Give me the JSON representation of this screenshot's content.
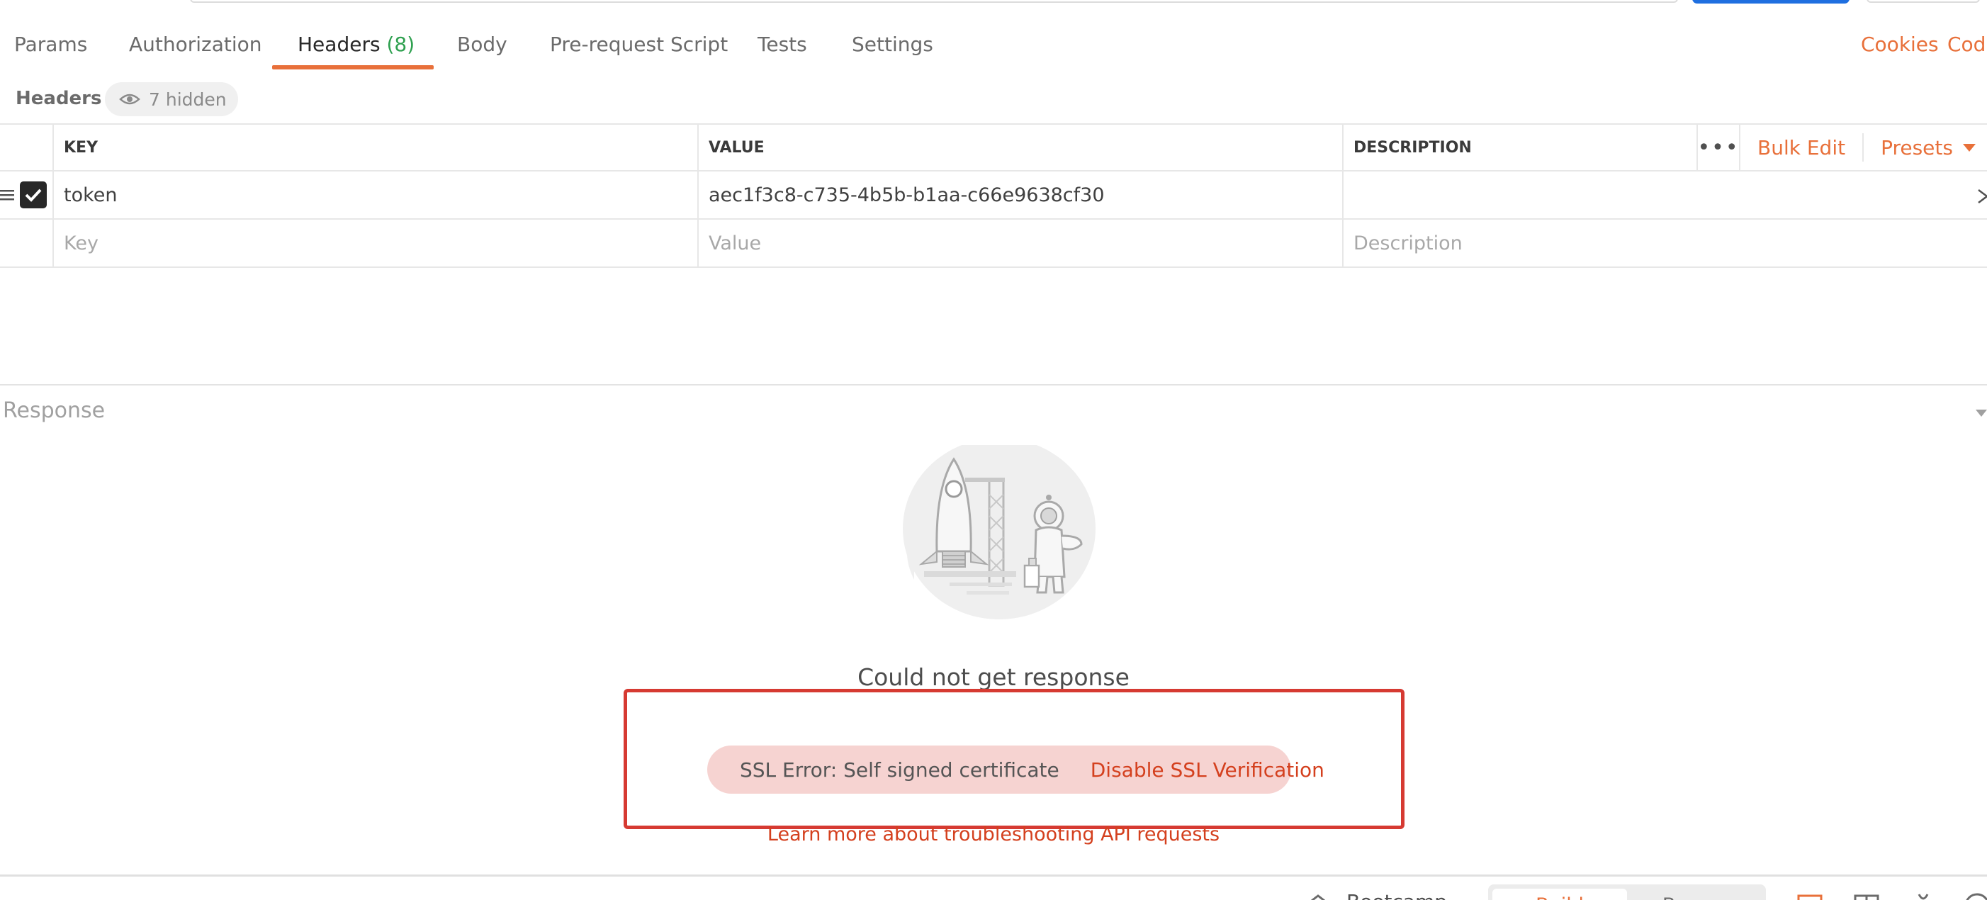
{
  "tabs": [
    {
      "label": "Params"
    },
    {
      "label": "Authorization"
    },
    {
      "label": "Headers",
      "count": "(8)"
    },
    {
      "label": "Body"
    },
    {
      "label": "Pre-request Script"
    },
    {
      "label": "Tests"
    },
    {
      "label": "Settings"
    }
  ],
  "active_tab": "Headers",
  "right_links": {
    "cookies": "Cookies",
    "code": "Code"
  },
  "headers_section": {
    "title": "Headers",
    "hidden_pill": "7 hidden"
  },
  "table": {
    "columns": {
      "key": "KEY",
      "value": "VALUE",
      "description": "DESCRIPTION"
    },
    "actions": {
      "bulk_edit": "Bulk Edit",
      "presets": "Presets"
    },
    "rows": [
      {
        "checked": true,
        "key": "token",
        "value": "aec1f3c8-c735-4b5b-b1aa-c66e9638cf30",
        "description": ""
      }
    ],
    "placeholders": {
      "key": "Key",
      "value": "Value",
      "description": "Description"
    }
  },
  "response": {
    "title": "Response",
    "empty_message": "Could not get response",
    "error": {
      "message": "SSL Error: Self signed certificate",
      "action": "Disable SSL Verification"
    },
    "learn_more": "Learn more about troubleshooting API requests"
  },
  "footer": {
    "bootcamp": "Bootcamp",
    "build": "Build",
    "browse": "Browse"
  },
  "colors": {
    "accent": "#e8703a",
    "error_red": "#d4401e",
    "highlight_border": "#d63a32",
    "error_pill_bg": "#f6d3d1",
    "count_green": "#2ea04f"
  }
}
